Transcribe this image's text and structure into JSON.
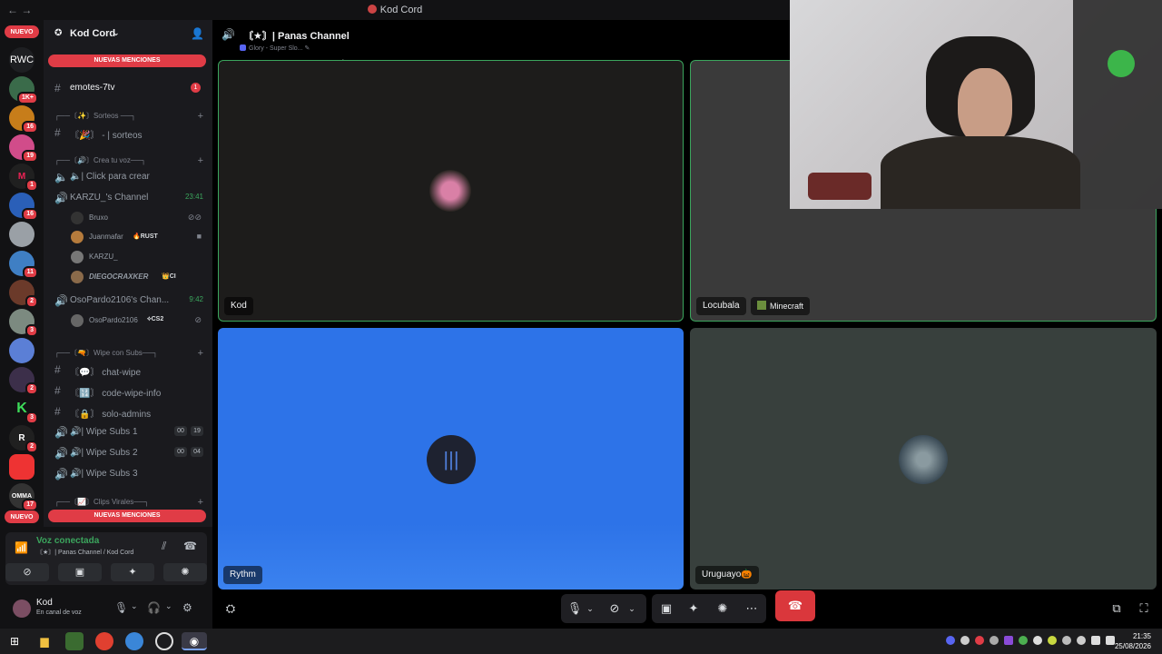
{
  "window": {
    "title": "Kod Cord"
  },
  "servers": {
    "new_label": "NUEVO",
    "rwc_label": "RWC",
    "badges": [
      "1K+",
      "16",
      "19",
      "1",
      "16",
      "11",
      "2",
      "3",
      "2",
      "3",
      "2",
      "17"
    ],
    "new_label_bottom": "NUEVO"
  },
  "guild": {
    "name": "Kod Cord"
  },
  "mentions": {
    "label": "NUEVAS MENCIONES"
  },
  "channels": {
    "emotes": {
      "label": "emotes-7tv",
      "unread": "1"
    },
    "cat_sorteos": "┌──〔✨〕Sorteos ──┐",
    "sorteos": "〘🎉〙 - | sorteos",
    "cat_voz": "┌──〔🔊〕Crea tu voz──┐",
    "click_crear": "🔈| Click para crear",
    "karzu_channel": {
      "label": "KARZU_'s Channel",
      "time": "23:41"
    },
    "karzu_users": [
      {
        "name": "Bruxo"
      },
      {
        "name": "Juanmafar",
        "tag": "🔥RUST"
      },
      {
        "name": "KARZU_"
      },
      {
        "name": "DIEGOCRAXKER",
        "tag": "👑CI"
      }
    ],
    "oso_channel": {
      "label": "OsoPardo2106's Chan...",
      "time": "9:42"
    },
    "oso_users": [
      {
        "name": "OsoPardo2106",
        "tag": "⟡CS2"
      }
    ],
    "cat_wipe": "┌──〔🔫〕Wipe con Subs──┐",
    "chat_wipe": "〘💬〙 chat-wipe",
    "code_wipe": "〘🔢〙 code-wipe-info",
    "solo_admins": "〘🔒〙 solo-admins",
    "wipe1": {
      "label": "🔊| Wipe Subs 1",
      "a": "00",
      "b": "19"
    },
    "wipe2": {
      "label": "🔊| Wipe Subs 2",
      "a": "00",
      "b": "04"
    },
    "wipe3": {
      "label": "🔊| Wipe Subs 3"
    },
    "cat_clips": "┌──〔📈〕Clips Virales──┐"
  },
  "voice": {
    "status": "Voz conectada",
    "sub": "〘★〙| Panas Channel / Kod Cord"
  },
  "user": {
    "name": "Kod",
    "status": "En canal de voz"
  },
  "stage": {
    "channel_name": "〘★〙| Panas Channel",
    "status": "Glory - Super Slo...",
    "tiles": [
      {
        "name": "Kod"
      },
      {
        "name": "Locubala",
        "activity": "Minecraft"
      },
      {
        "name": "Rythm"
      },
      {
        "name": "Uruguayo🎃"
      }
    ]
  },
  "clock": {
    "time": "21:35",
    "date": "25/08/2026"
  },
  "colors": {
    "accent": "#da373c",
    "speaking": "#3ba55d",
    "rythm_blue": "#2d73e8",
    "mention_red": "#e03c46"
  },
  "icons": [
    "back-arrow-icon",
    "speaker-icon",
    "hash-icon",
    "mic-icon",
    "headphones-icon",
    "gear-icon",
    "screen-share-icon",
    "activities-icon",
    "hangup-icon",
    "popout-icon",
    "fullscreen-icon"
  ]
}
